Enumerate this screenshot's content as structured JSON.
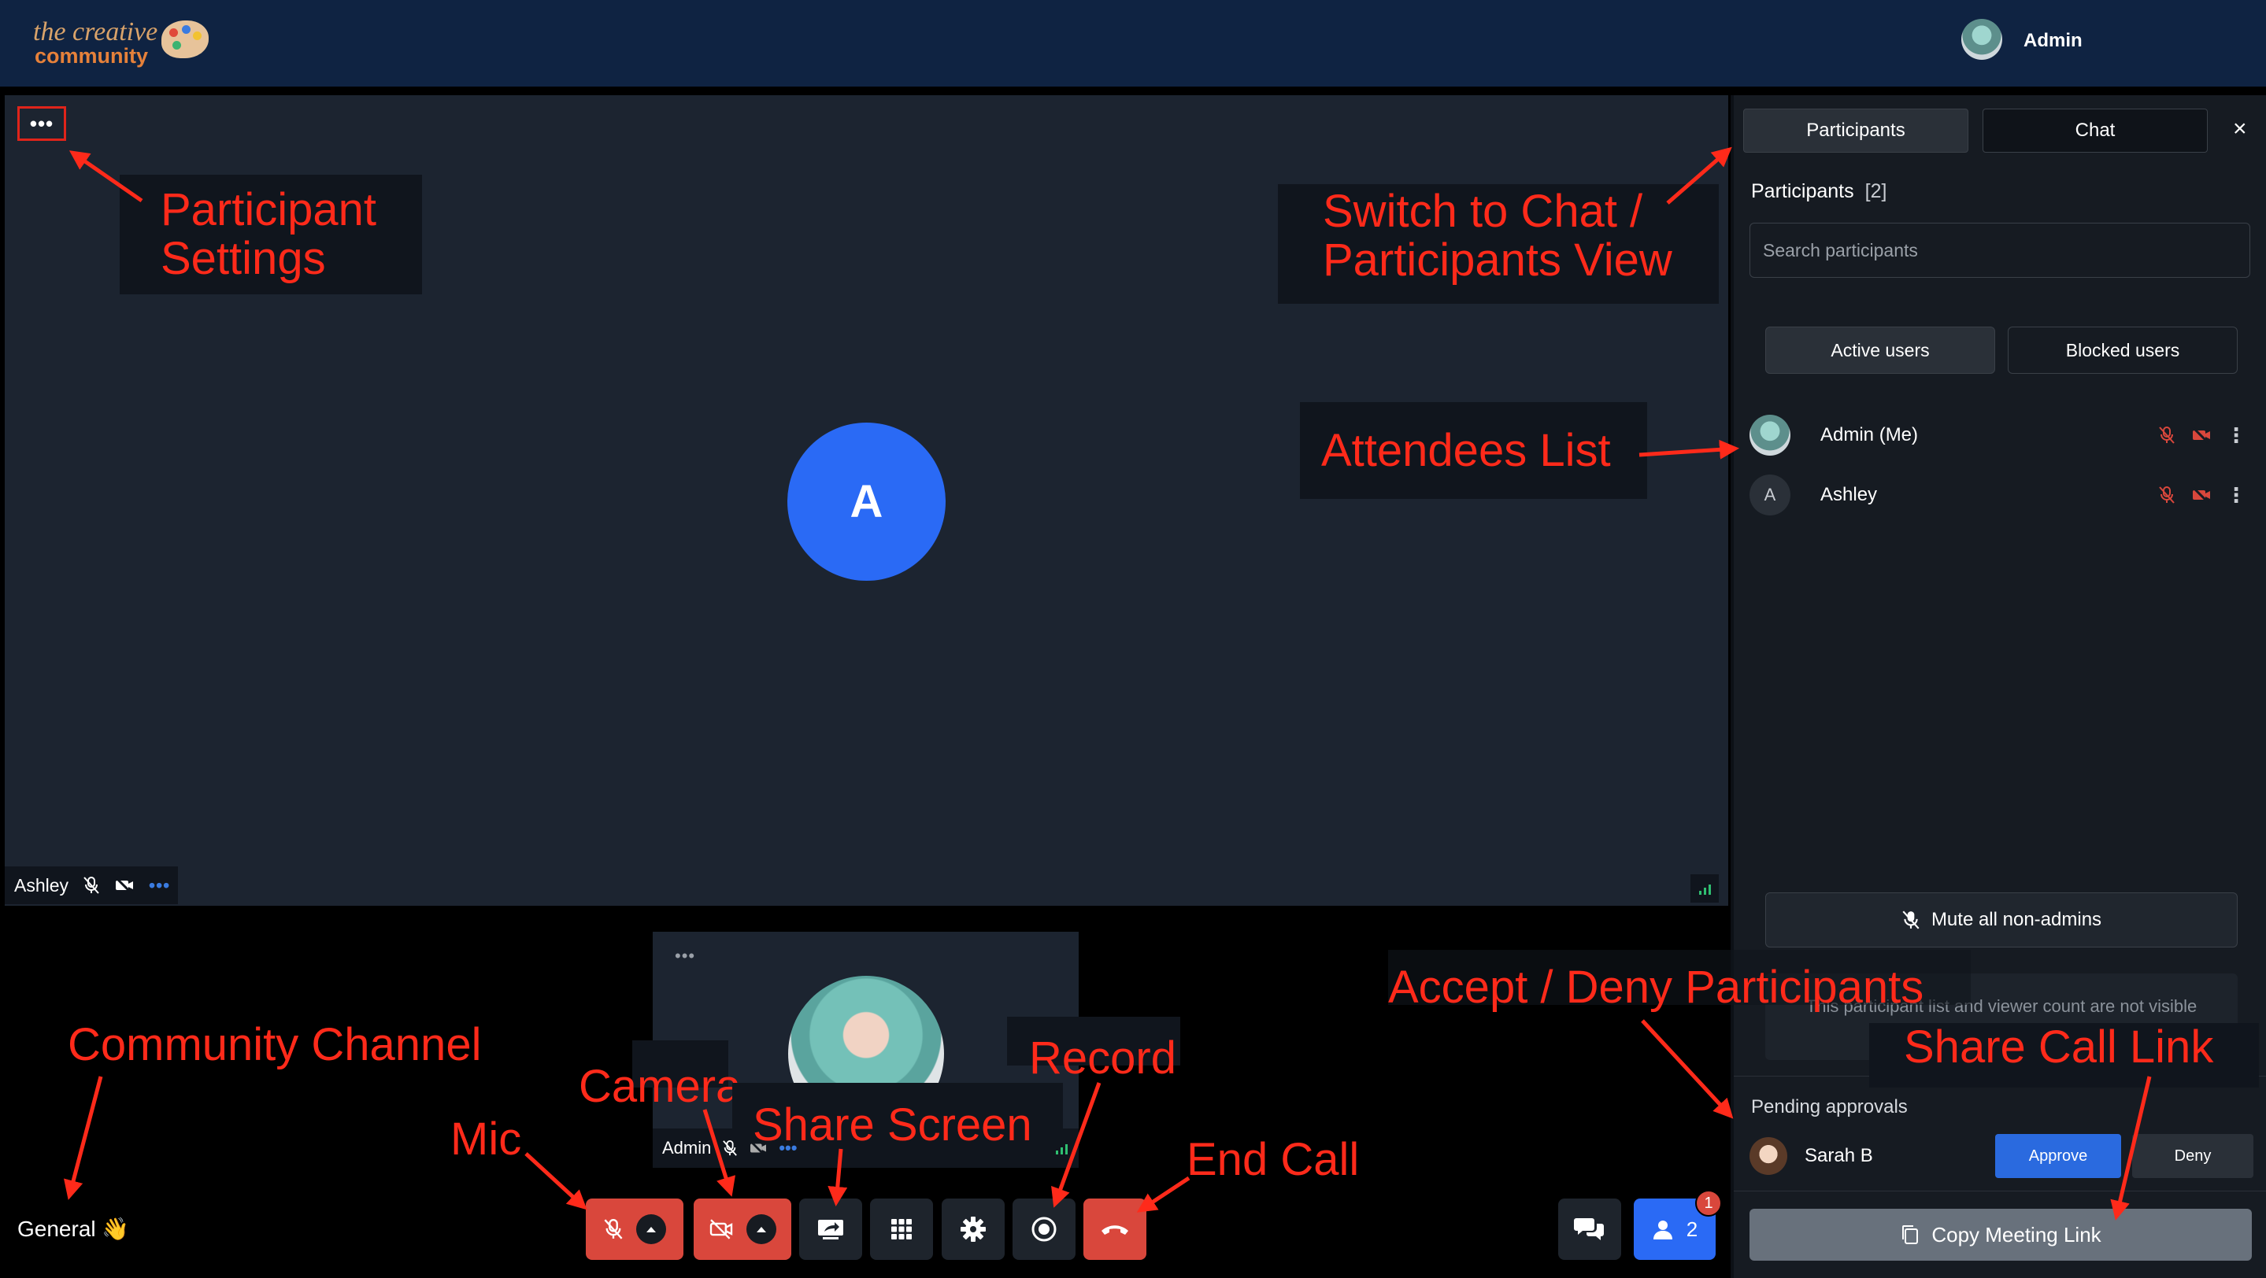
{
  "header": {
    "logo_line1": "the creative",
    "logo_line2": "community",
    "user_name": "Admin"
  },
  "main_video": {
    "avatar_initial": "A",
    "participant_name": "Ashley"
  },
  "self_view": {
    "name": "Admin"
  },
  "sidebar": {
    "tab_participants": "Participants",
    "tab_chat": "Chat",
    "close_glyph": "×",
    "heading": "Participants",
    "count": "[2]",
    "search_placeholder": "Search participants",
    "filter_active": "Active users",
    "filter_blocked": "Blocked users",
    "participants": [
      {
        "name": "Admin (Me)",
        "initial": ""
      },
      {
        "name": "Ashley",
        "initial": "A"
      }
    ],
    "mute_all_label": "Mute all non-admins",
    "note": "This participant list and viewer count are not visible to students or guests.",
    "pending_title": "Pending approvals",
    "pending": [
      {
        "name": "Sarah B",
        "approve": "Approve",
        "deny": "Deny"
      }
    ],
    "copy_link_label": "Copy Meeting Link"
  },
  "bottom_bar": {
    "channel_label": "General 👋",
    "participants_count": "2",
    "notification_badge": "1"
  },
  "annotations": {
    "participant_settings": [
      "Participant",
      "Settings"
    ],
    "switch_view": [
      "Switch to Chat /",
      "Participants View"
    ],
    "attendees_list": "Attendees List",
    "community_channel": "Community Channel",
    "camera": "Camera",
    "mic": "Mic",
    "share_screen": "Share Screen",
    "record": "Record",
    "end_call": "End Call",
    "accept_deny": "Accept / Deny Participants",
    "share_call_link": "Share Call Link"
  },
  "colors": {
    "header_bg": "#0f2342",
    "video_bg": "#1c2430",
    "sidebar_bg": "#161b22",
    "accent_blue": "#2a6af5",
    "danger_red": "#d9473c",
    "annotation_red": "#ff2a1a"
  }
}
